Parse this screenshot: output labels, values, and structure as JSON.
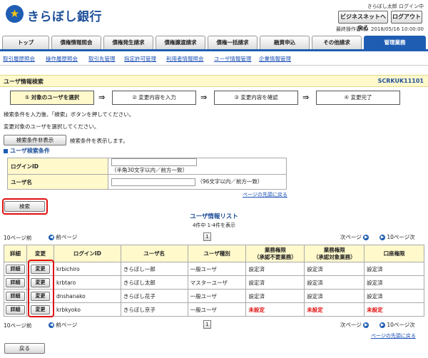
{
  "header": {
    "logo_text": "きらぼし銀行",
    "user_status": "きらぼし太郎 ログイン中",
    "biz_help_label": "ビジネスネットヘ戻る",
    "logout_label": "ログアウト",
    "last_login": "最終操作日時：2018/05/16 10:00:00"
  },
  "tabs": [
    {
      "label": "トップ"
    },
    {
      "label": "債権情報照会"
    },
    {
      "label": "債権発生請求"
    },
    {
      "label": "債権譲渡請求"
    },
    {
      "label": "債権一括請求"
    },
    {
      "label": "融資申込"
    },
    {
      "label": "その他請求"
    },
    {
      "label": "管理業務"
    }
  ],
  "subnav": [
    {
      "label": "取引履歴照会"
    },
    {
      "label": "操作履歴照会"
    },
    {
      "label": "取引先管理"
    },
    {
      "label": "指定許可管理"
    },
    {
      "label": "利用者情報照会"
    },
    {
      "label": "ユーザ情報管理"
    },
    {
      "label": "企業情報管理"
    }
  ],
  "page": {
    "title": "ユーザ情報検索",
    "screen_id": "SCRKUK11101"
  },
  "steps": [
    {
      "label": "① 対象のユーザを選択"
    },
    {
      "label": "② 変更内容を入力"
    },
    {
      "label": "③ 変更内容を確認"
    },
    {
      "label": "④ 変更完了"
    }
  ],
  "messages": {
    "line1": "検索条件を入力後、「検索」ボタンを押してください。",
    "line2": "変更対象のユーザを選択してください。",
    "hide_conditions_label": "検索条件非表示",
    "hide_conditions_note": "検索条件を表示します。"
  },
  "search": {
    "section_title": "ユーザ検索条件",
    "login_id_label": "ログインID",
    "login_id_note": "（半角30文字以内／前方一致）",
    "user_name_label": "ユーザ名",
    "user_name_note": "（96文字以内／前方一致）",
    "back_to_top": "ページの先頭に戻る",
    "search_button": "検索"
  },
  "list": {
    "title": "ユーザ情報リスト",
    "count": "4件中 1-4件を表示",
    "prev10": "10ページ前",
    "prev": "前ページ",
    "page_no": "1",
    "next": "次ページ",
    "next10": "10ページ次",
    "headers": [
      "詳細",
      "変更",
      "ログインID",
      "ユーザ名",
      "ユーザ種別",
      "業務権限\n（承認不要業務）",
      "業務権限\n（承認対象業務）",
      "口座権限"
    ],
    "detail_label": "詳細",
    "change_label": "変更",
    "rows": [
      {
        "login_id": "krbichiro",
        "name": "きらぼし一郎",
        "type": "一般ユーザ",
        "auth1": "設定済",
        "auth2": "設定済",
        "account": "設定済"
      },
      {
        "login_id": "krbtaro",
        "name": "きらぼし太郎",
        "type": "マスターユーザ",
        "auth1": "設定済",
        "auth2": "設定済",
        "account": "設定済"
      },
      {
        "login_id": "dnshanako",
        "name": "きらぼし花子",
        "type": "一般ユーザ",
        "auth1": "設定済",
        "auth2": "設定済",
        "account": "設定済"
      },
      {
        "login_id": "krbkyoko",
        "name": "きらぼし京子",
        "type": "一般ユーザ",
        "auth1": "未設定",
        "auth2": "未設定",
        "account": "未設定"
      }
    ],
    "back_to_top": "ページの先頭に戻る",
    "back_button": "戻る"
  }
}
